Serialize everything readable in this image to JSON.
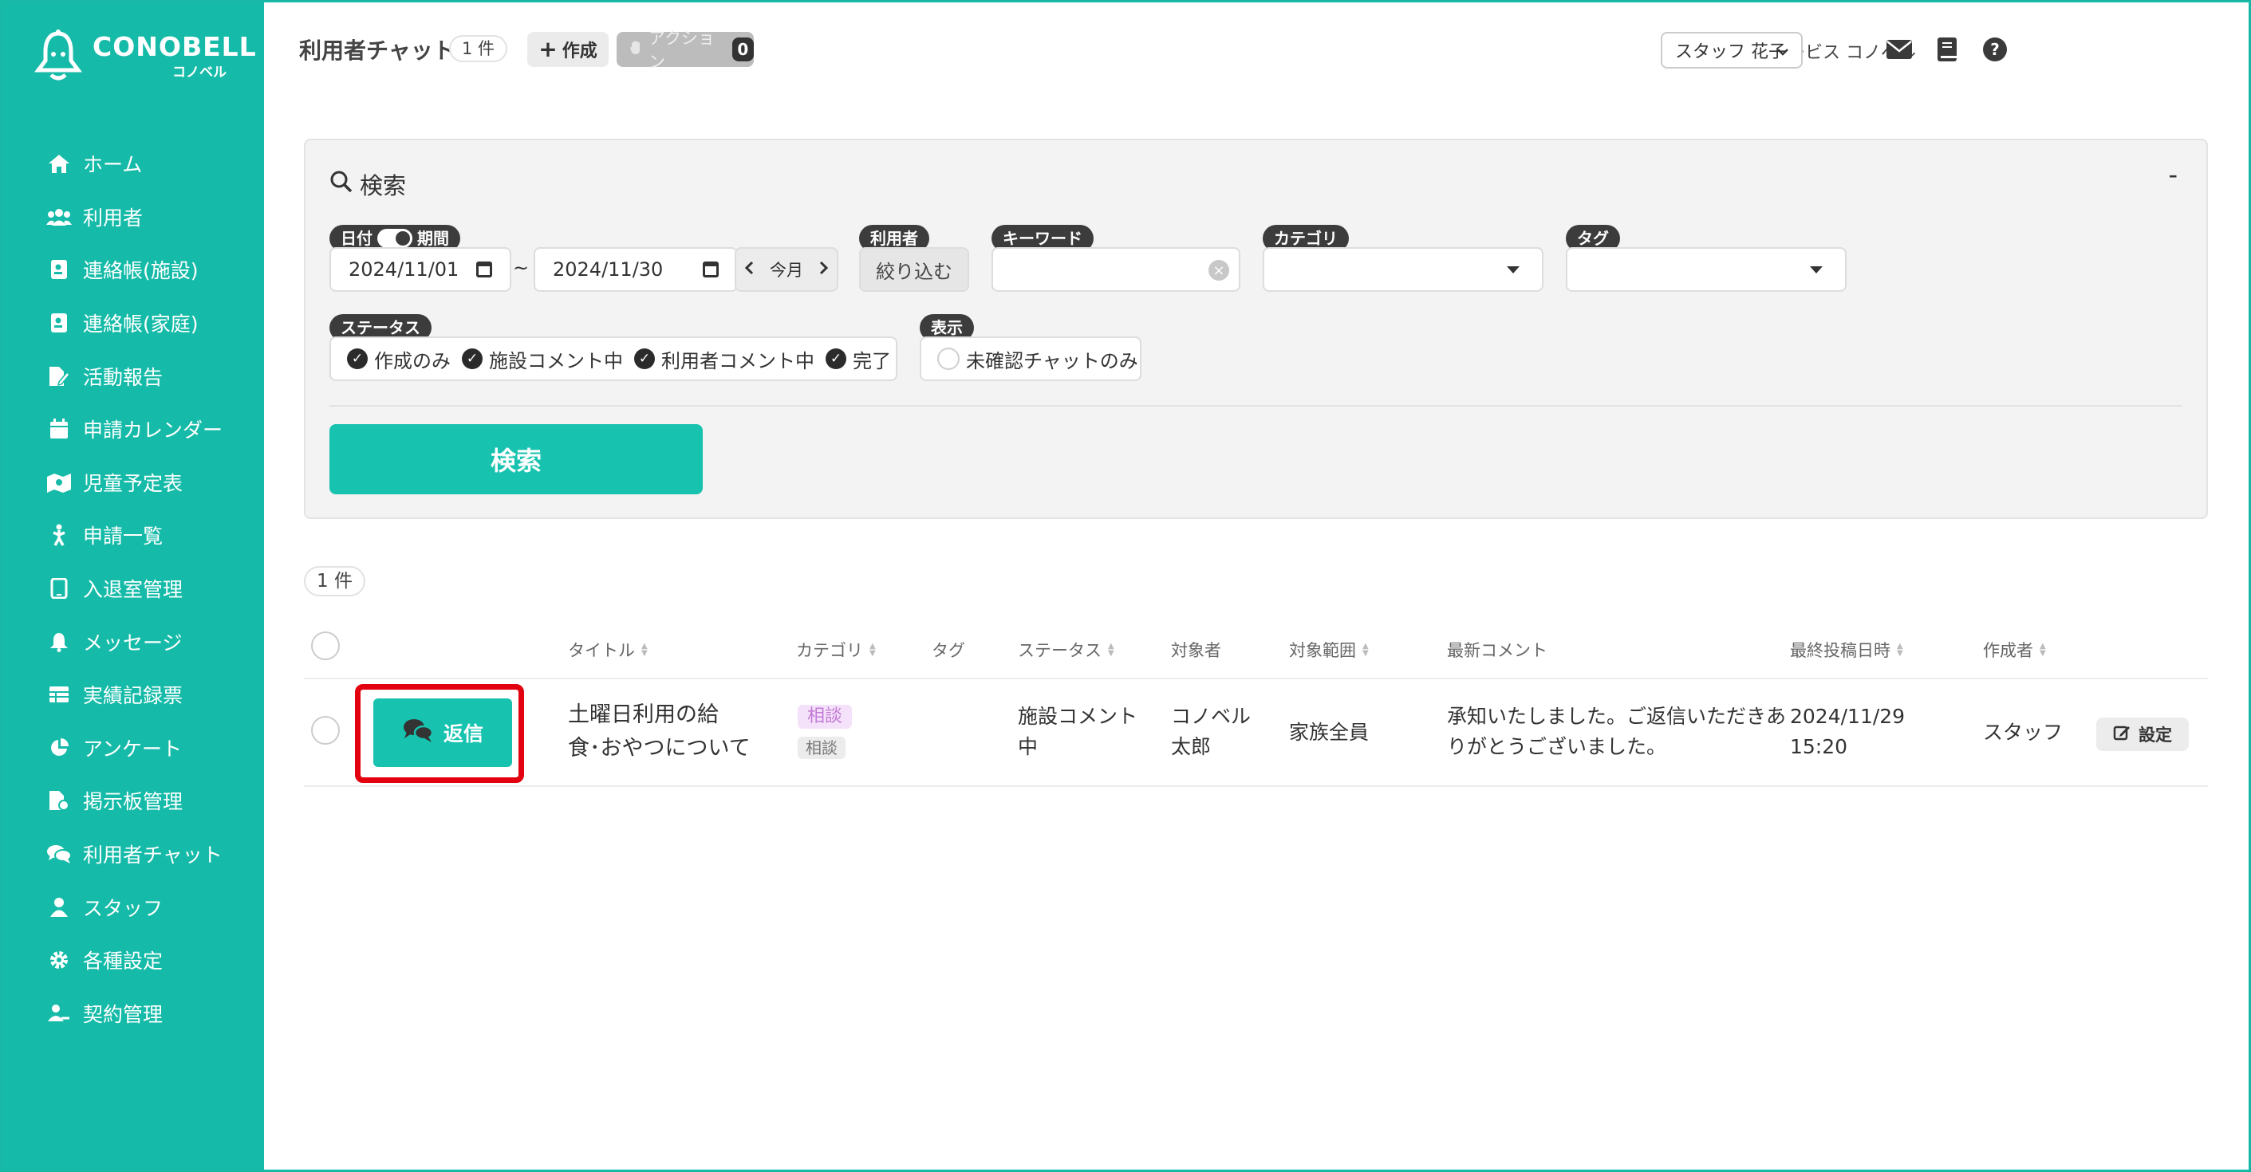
{
  "brand": {
    "name_en": "CONOBELL",
    "name_jp": "コノベル",
    "accent": "#15bba8"
  },
  "sidebar": {
    "items": [
      {
        "label": "ホーム",
        "icon": "home-icon"
      },
      {
        "label": "利用者",
        "icon": "users-icon"
      },
      {
        "label": "連絡帳(施設)",
        "icon": "contact-book-icon"
      },
      {
        "label": "連絡帳(家庭)",
        "icon": "contact-book-icon"
      },
      {
        "label": "活動報告",
        "icon": "report-icon"
      },
      {
        "label": "申請カレンダー",
        "icon": "calendar-icon"
      },
      {
        "label": "児童予定表",
        "icon": "schedule-icon"
      },
      {
        "label": "申請一覧",
        "icon": "application-icon"
      },
      {
        "label": "入退室管理",
        "icon": "tablet-icon"
      },
      {
        "label": "メッセージ",
        "icon": "bell-icon"
      },
      {
        "label": "実績記録票",
        "icon": "table-icon"
      },
      {
        "label": "アンケート",
        "icon": "pie-chart-icon"
      },
      {
        "label": "掲示板管理",
        "icon": "board-icon"
      },
      {
        "label": "利用者チャット",
        "icon": "chat-icon"
      },
      {
        "label": "スタッフ",
        "icon": "staff-icon"
      },
      {
        "label": "各種設定",
        "icon": "gear-icon"
      },
      {
        "label": "契約管理",
        "icon": "contract-icon"
      }
    ]
  },
  "header": {
    "title": "利用者チャット",
    "count": "1 件",
    "create_label": "作成",
    "action_label": "アクション",
    "action_count": "0",
    "facility": "放課後デイサービス コノベル",
    "staff_name": "スタッフ 花子"
  },
  "search": {
    "heading": "検索",
    "collapse": "-",
    "date_label_left": "日付",
    "date_label_right": "期間",
    "date_from": "2024/11/01",
    "tilde": "~",
    "date_to": "2024/11/30",
    "this_month": "今月",
    "user_label": "利用者",
    "filter_button": "絞り込む",
    "keyword_label": "キーワード",
    "keyword_value": "",
    "category_label": "カテゴリ",
    "category_value": "",
    "tag_label": "タグ",
    "tag_value": "",
    "status_label": "ステータス",
    "statuses": [
      "作成のみ",
      "施設コメント中",
      "利用者コメント中",
      "完了"
    ],
    "display_label": "表示",
    "display_option": "未確認チャットのみ",
    "search_button": "検索"
  },
  "results": {
    "count": "1 件",
    "columns": {
      "title": "タイトル",
      "category": "カテゴリ",
      "tag": "タグ",
      "status": "ステータス",
      "target": "対象者",
      "scope": "対象範囲",
      "latest_comment": "最新コメント",
      "last_posted": "最終投稿日時",
      "author": "作成者"
    },
    "rows": [
      {
        "reply_label": "返信",
        "title_line1": "土曜日利用の給",
        "title_line2": "食･おやつについて",
        "category_primary": "相談",
        "category_secondary": "相談",
        "status_line1": "施設コメント",
        "status_line2": "中",
        "target_line1": "コノベル",
        "target_line2": "太郎",
        "scope": "家族全員",
        "comment_line1": "承知いたしました。ご返信いただきあ",
        "comment_line2": "りがとうございました。",
        "date_line1": "2024/11/29",
        "date_line2": "15:20",
        "author": "スタッフ",
        "settings_label": "設定"
      }
    ]
  }
}
